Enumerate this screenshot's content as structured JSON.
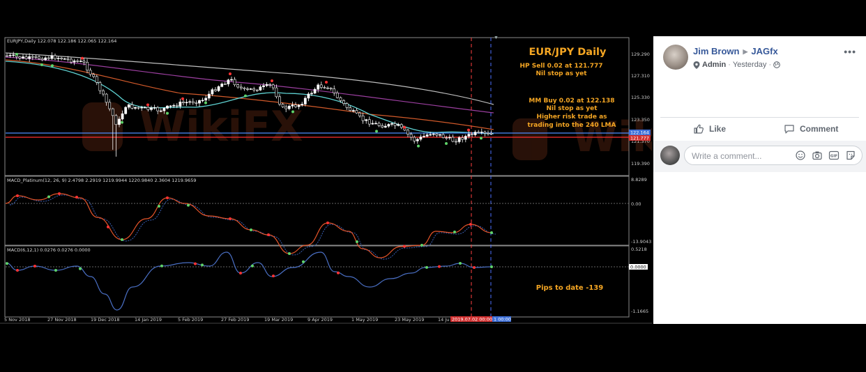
{
  "chart": {
    "header": "EURJPY,Daily  122.078 122.186 122.065 122.164",
    "annotations": {
      "title": "EUR/JPY Daily",
      "hp_sell": "HP Sell 0.02 at 121.777",
      "hp_stop": "Nil stop as yet",
      "mm_buy": "MM Buy 0.02 at 122.138",
      "mm_stop": "Nil stop as yet",
      "mm_note1": "Higher risk trade as",
      "mm_note2": "trading into the 240 LMA",
      "pips": "Pips to date -139"
    },
    "price_axis": [
      "129.290",
      "127.310",
      "125.330",
      "123.350",
      "121.370",
      "119.390"
    ],
    "price_markers": {
      "blue": "122.164",
      "red": "121.777"
    },
    "macd1_label": "MACD_Platinum(12, 26, 9) 2.4798 2.2919 1219.9944 1220.9840 2.3604 1219.9659",
    "macd1_axis": [
      "8.8289",
      "0.00",
      "-13.9043"
    ],
    "macd2_label": "MACD(6,12,1) 0.0276 0.0276 0.0000",
    "macd2_axis": [
      "0.5218",
      "0.0000",
      "-1.1665"
    ],
    "dates": [
      "5 Nov 2018",
      "27 Nov 2018",
      "19 Dec 2018",
      "14 Jan 2019",
      "5 Feb 2019",
      "27 Feb 2019",
      "19 Mar 2019",
      "9 Apr 2019",
      "1 May 2019",
      "23 May 2019",
      "14 Ju"
    ],
    "date_marker_red": "2019.07.02 00:00",
    "date_marker_blue": "1 00:00",
    "watermark": "WikiFX",
    "colors": {
      "candle": "#ffffff",
      "ma_fast": "#5fd3d3",
      "ma_mid": "#d25a2a",
      "ma_slow": "#9c3fa0",
      "ma_240": "#bfbfbf",
      "macd_line": "#e8552a",
      "macd2_line": "#4a6fc4",
      "bull_dot": "#5fd36a",
      "bear_dot": "#ff3333",
      "annot_gold": "#f5a623"
    }
  },
  "post": {
    "author": "Jim Brown",
    "group": "JAGfx",
    "role": "Admin",
    "time": "Yesterday",
    "like_label": "Like",
    "comment_label": "Comment",
    "comment_placeholder": "Write a comment...",
    "more_label": "•••"
  }
}
